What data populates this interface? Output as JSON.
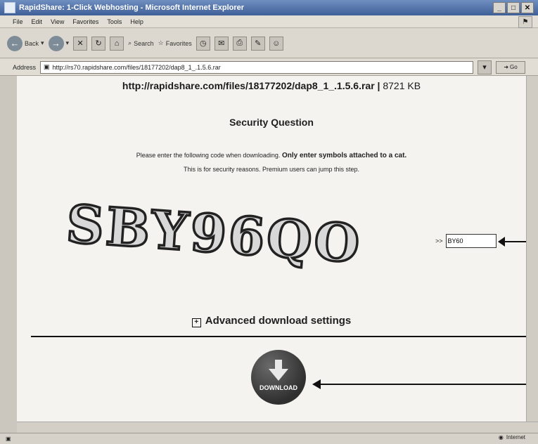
{
  "window": {
    "title": "RapidShare: 1-Click Webhosting - Microsoft Internet Explorer",
    "buttons": [
      "_",
      "□",
      "✕"
    ]
  },
  "menubar": [
    "File",
    "Edit",
    "View",
    "Favorites",
    "Tools",
    "Help"
  ],
  "toolbar": {
    "back_label": "Back",
    "search_label": "Search",
    "favorites_label": "Favorites"
  },
  "addressbar": {
    "label": "Address",
    "url": "http://rs70.rapidshare.com/files/18177202/dap8_1_.1.5.6.rar",
    "go_label": "Go"
  },
  "page": {
    "file_url": "http://rapidshare.com/files/18177202/dap8_1_.1.5.6.rar",
    "size_separator": " | ",
    "file_size": "8721 KB",
    "security_title": "Security Question",
    "instruction_prefix": "Please enter the following code when downloading.",
    "instruction_bold": "Only enter symbols attached to a cat.",
    "instruction_line2": "This is for security reasons. Premium users can jump this step.",
    "captcha_text": "SBY96QO",
    "entry_marker": ">>",
    "captcha_input_value": "BY60",
    "advanced_label": "Advanced download settings",
    "download_label": "DOWNLOAD"
  },
  "status": {
    "zone_label": "Internet"
  }
}
